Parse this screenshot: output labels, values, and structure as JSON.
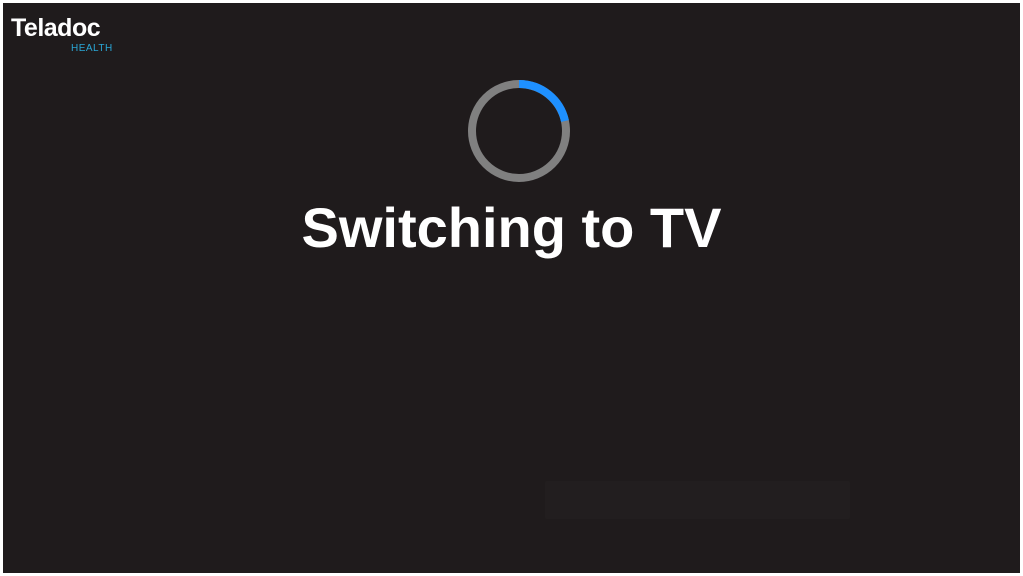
{
  "brand": {
    "name": "Teladoc",
    "sub": "HEALTH",
    "accent": "#2aa7d6"
  },
  "loading": {
    "icon": "spinner-icon",
    "track_color": "#808080",
    "arc_color": "#1e90ff",
    "background": "#1f1b1c"
  },
  "message": {
    "title": "Switching to TV"
  }
}
